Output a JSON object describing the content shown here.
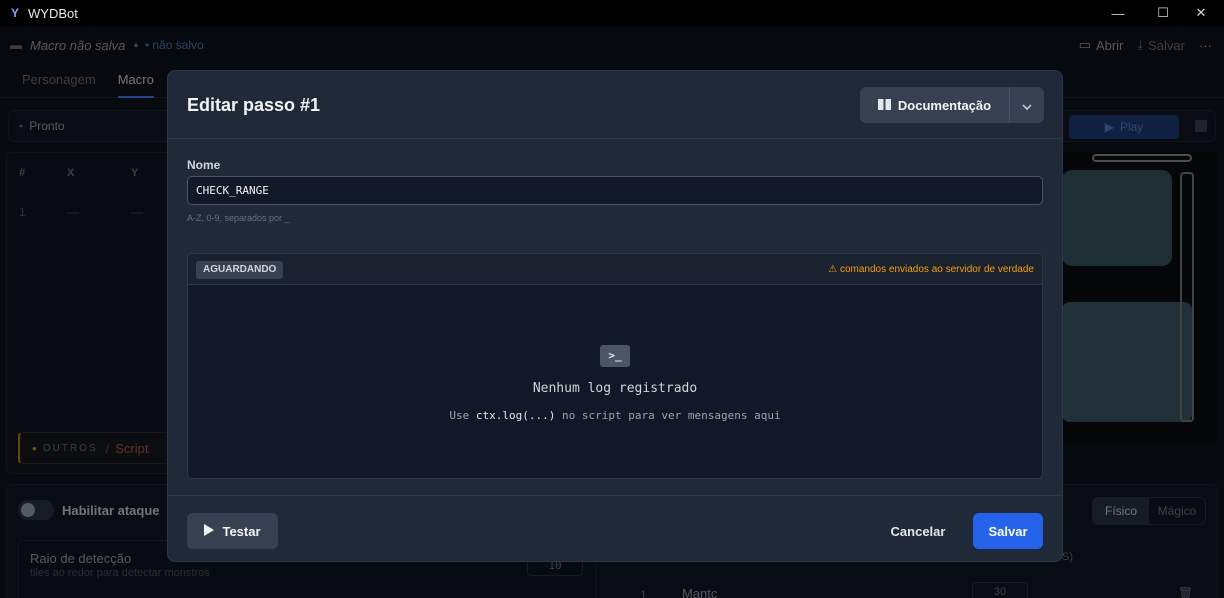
{
  "window": {
    "title": "WYDBot",
    "minimize": "—",
    "maximize": "☐",
    "close": "✕"
  },
  "toolbar": {
    "macro_name": "Macro não salva",
    "dot": "●",
    "status": "• não salvo",
    "open_label": "Abrir",
    "save_label": "Salvar",
    "more": "···"
  },
  "tabs": [
    {
      "label": "Personagem"
    },
    {
      "label": "Macro"
    }
  ],
  "run_status": {
    "text": "Pronto",
    "play_label": "Play"
  },
  "grid": {
    "headers": [
      "#",
      "X",
      "Y"
    ],
    "row": [
      "1",
      "—",
      "—"
    ]
  },
  "category": {
    "group": "OUTROS",
    "sep": "/",
    "name": "Script"
  },
  "attack": {
    "toggle_label": "Habilitar ataque",
    "radius_label": "Raio de detecção",
    "radius_hint": "tiles ao redor para detectar monstros",
    "radius_value": "10",
    "modes": [
      "Físico",
      "Mágico"
    ],
    "s_letter": "S)",
    "row_num": "1",
    "row_name": "Mantc",
    "row_value": "30"
  },
  "modal": {
    "title": "Editar passo #1",
    "doc_label": "Documentação",
    "name_label": "Nome",
    "name_value": "CHECK_RANGE",
    "name_hint": "A-Z, 0-9, separados por _",
    "log_badge": "AGUARDANDO",
    "log_warning": "⚠ comandos enviados ao servidor de verdade",
    "empty_title": "Nenhum log registrado",
    "empty_sub_prefix": "Use",
    "empty_sub_code": "ctx.log(...)",
    "empty_sub_suffix": "no script para ver mensagens aqui",
    "test_label": "Testar",
    "cancel_label": "Cancelar",
    "save_label": "Salvar"
  },
  "colors": {
    "accent": "#2563eb",
    "warning": "#f59e0b",
    "modal_bg": "#1f2937"
  }
}
